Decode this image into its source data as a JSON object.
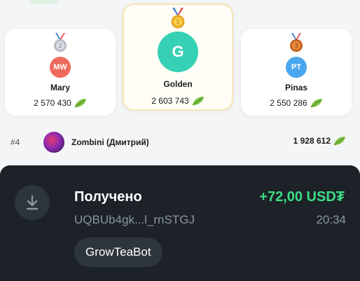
{
  "leaderboard": {
    "podium": [
      {
        "position": "second",
        "initials": "MW",
        "name": "Mary",
        "score": "2 570 430",
        "medal_icon": "silver-medal-icon",
        "avatar_color": "#ee6a5c"
      },
      {
        "position": "first",
        "initials": "G",
        "name": "Golden",
        "score": "2 603 743",
        "medal_icon": "gold-medal-icon",
        "avatar_color": "#36d1b4"
      },
      {
        "position": "third",
        "initials": "PT",
        "name": "Pinas",
        "score": "2 550 286",
        "medal_icon": "bronze-medal-icon",
        "avatar_color": "#4aa6ee"
      }
    ],
    "rows": [
      {
        "rank": "#4",
        "name": "Zombini (Дмитрий)",
        "score": "1 928 612"
      }
    ],
    "score_icon": "tea-leaf-icon"
  },
  "notification": {
    "icon": "download-icon",
    "title": "Получено",
    "amount": "+72,00 USD₮",
    "address": "UQBUb4gk...l_rnSTGJ",
    "time": "20:34",
    "source_chip": "GrowTeaBot",
    "colors": {
      "background": "#1c2227",
      "amount": "#3ddc84",
      "muted": "#8c959e"
    }
  }
}
